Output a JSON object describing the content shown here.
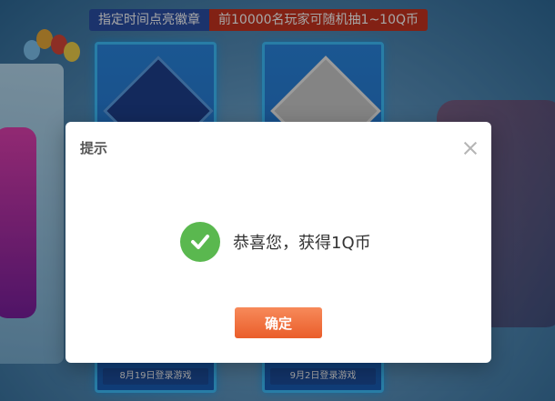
{
  "banner": {
    "left_text": "指定时间点亮徽章",
    "right_text": "前10000名玩家可随机抽1~10Q币"
  },
  "cards": [
    {
      "footer": "8月19日登录游戏"
    },
    {
      "footer": "9月2日登录游戏"
    }
  ],
  "dialog": {
    "title": "提示",
    "message": "恭喜您，获得1Q币",
    "confirm_label": "确定"
  },
  "icons": {
    "close": "close-icon",
    "success": "check-circle-icon"
  },
  "colors": {
    "success_green": "#5ab84f",
    "button_orange": "#ea5d2a"
  }
}
